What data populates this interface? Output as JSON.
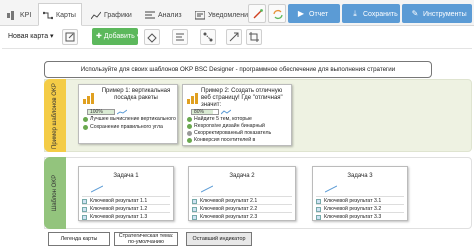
{
  "tabs": [
    {
      "label": "KPI",
      "icon": "kpi-icon"
    },
    {
      "label": "Карты",
      "icon": "map-icon"
    },
    {
      "label": "Графики",
      "icon": "chart-icon"
    },
    {
      "label": "Анализ",
      "icon": "analysis-icon"
    },
    {
      "label": "Уведомления",
      "icon": "bell-icon"
    }
  ],
  "topbar": {
    "report_label": "Отчет",
    "save_label": "Сохранить",
    "tools_label": "Инструменты",
    "accent": "#5b9bd5"
  },
  "toolbar": {
    "map_select": "Новая карта",
    "add_label": "Добавить",
    "add_color": "#5cb85c"
  },
  "intro_text": "Используйте для своих шаблонов OKP BSC Designer - программное обеспечение для выполнения стратегии",
  "bands": [
    {
      "label": "Пример шаблонов OKP",
      "color": "#f4cc46",
      "bg": "#eef2e2"
    },
    {
      "label": "Шаблон OKP",
      "color": "#93c47d",
      "bg": "#ffffff"
    }
  ],
  "examples": [
    {
      "title": "Пример 1: вертикальная посадка ракеты",
      "progress": "100%",
      "progress_fraction": 1.0,
      "metrics": [
        {
          "label": "Лучшее вычисление вертикального"
        },
        {
          "label": "Сохранение правильного угла"
        }
      ]
    },
    {
      "title": "Пример 2: Создать отличную веб страницу! Где \"отличная\" значит:",
      "progress": "80%",
      "progress_fraction": 0.8,
      "metrics": [
        {
          "label": "Найдите 5 тем, которые"
        },
        {
          "label": "Responsive дизайн бинарный"
        },
        {
          "label": "Скорректированный показатель"
        },
        {
          "label": "Конверсия посетителей в"
        }
      ]
    }
  ],
  "tasks": [
    {
      "title": "Задача 1",
      "results": [
        "Ключевой результат 1.1",
        "Ключевой результат 1.2",
        "Ключевой результат 1.3"
      ]
    },
    {
      "title": "Задача 2",
      "results": [
        "Ключевой результат 2.1",
        "Ключевой результат 2.2",
        "Ключевой результат 2.3"
      ]
    },
    {
      "title": "Задача 3",
      "results": [
        "Ключевой результат 3.1",
        "Ключевой результат 3.2",
        "Ключевой результат 3.3"
      ]
    }
  ],
  "legend": {
    "map_legend": "Легенда карты",
    "strategic_theme": "Стратегическая тема: по-умолчанию",
    "remaining_indicator": "Оставший индикатор"
  }
}
